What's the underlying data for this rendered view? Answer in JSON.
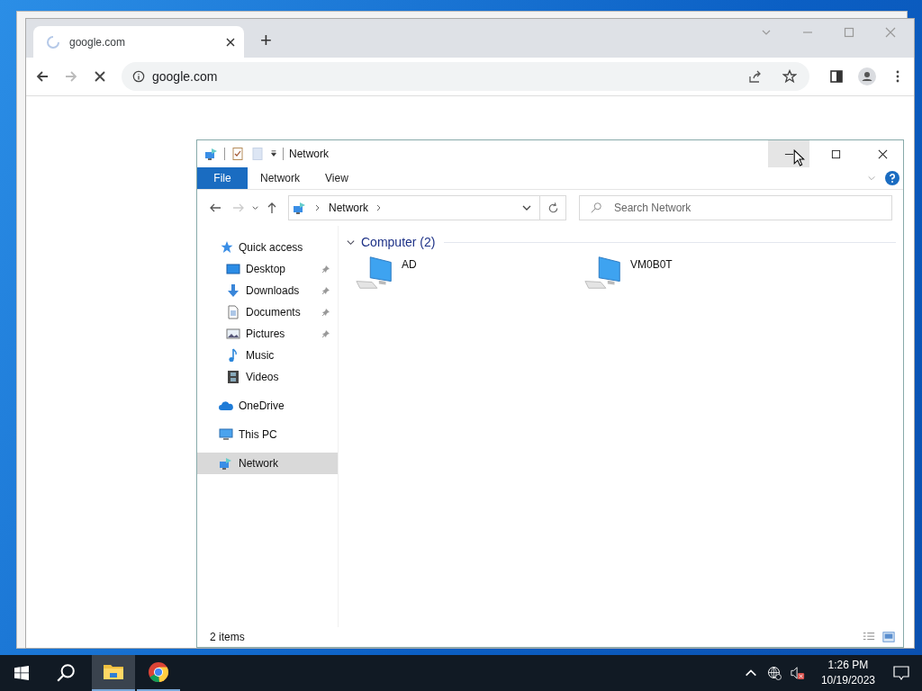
{
  "browser": {
    "tab": {
      "title": "google.com",
      "loading": true
    },
    "new_tab": "+",
    "address": "google.com"
  },
  "explorer": {
    "title": "Network",
    "minimize_hovered": true,
    "ribbon_tabs": [
      {
        "label": "File",
        "kind": "menu",
        "selected": false
      },
      {
        "label": "Network",
        "kind": "tab",
        "selected": false
      },
      {
        "label": "View",
        "kind": "tab",
        "selected": false
      }
    ],
    "breadcrumb": [
      "Network"
    ],
    "search": {
      "placeholder": "Search Network"
    },
    "nav": [
      {
        "label": "Quick access",
        "kind": "star",
        "selected": false,
        "children": [
          {
            "label": "Desktop",
            "kind": "desktop",
            "pinned": true,
            "selected": false
          },
          {
            "label": "Downloads",
            "kind": "download",
            "pinned": true,
            "selected": false
          },
          {
            "label": "Documents",
            "kind": "document",
            "pinned": true,
            "selected": false
          },
          {
            "label": "Pictures",
            "kind": "pictures",
            "pinned": true,
            "selected": false
          },
          {
            "label": "Music",
            "kind": "music",
            "pinned": false,
            "selected": false
          },
          {
            "label": "Videos",
            "kind": "videos",
            "pinned": false,
            "selected": false
          }
        ]
      },
      {
        "label": "OneDrive",
        "kind": "cloud",
        "selected": false
      },
      {
        "label": "This PC",
        "kind": "pc",
        "selected": false
      },
      {
        "label": "Network",
        "kind": "network",
        "selected": true
      }
    ],
    "group": {
      "label": "Computer (2)",
      "expanded": true
    },
    "items": [
      {
        "name": "AD"
      },
      {
        "name": "VM0B0T"
      }
    ],
    "status": "2 items"
  },
  "taskbar": {
    "apps": [
      {
        "kind": "explorer",
        "selected": true
      },
      {
        "kind": "chrome",
        "selected": false
      }
    ],
    "time": "1:26 PM",
    "date": "10/19/2023"
  }
}
